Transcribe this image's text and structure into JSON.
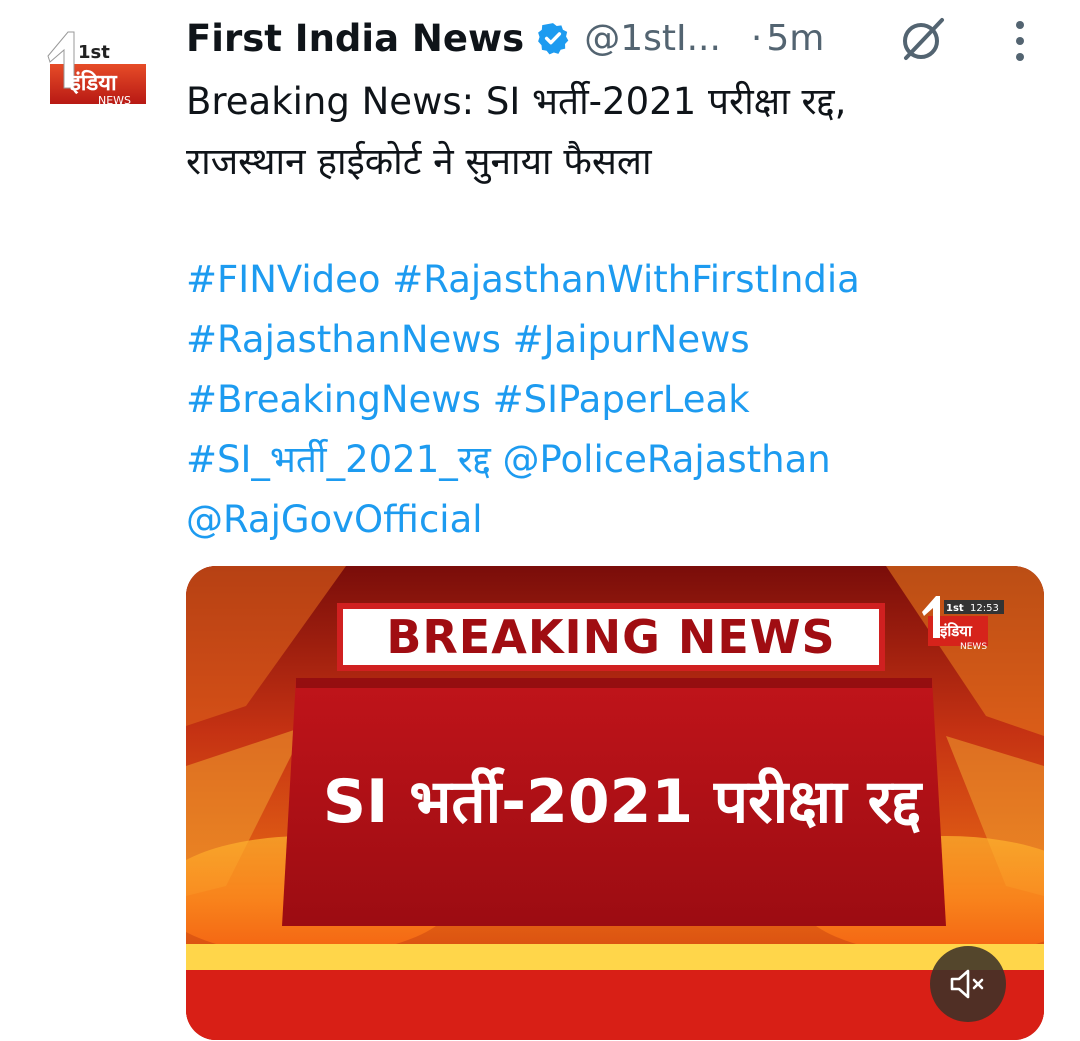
{
  "tweet": {
    "author_name": "First India News",
    "handle": "@1stI...",
    "separator": "·",
    "time": "5m",
    "text_lines": [
      "Breaking News: SI भर्ती-2021 परीक्षा रद्द,",
      "राजस्थान हाईकोर्ट ने सुनाया फैसला"
    ],
    "hashtag_lines": [
      "#FINVideo #RajasthanWithFirstIndia",
      "#RajasthanNews #JaipurNews",
      "#BreakingNews  #SIPaperLeak",
      "#SI_भर्ती_2021_रद्द @PoliceRajasthan",
      "@RajGovOfficial"
    ]
  },
  "avatar_logo": {
    "top": "1st",
    "middle": "इंडिया",
    "bottom": "NEWS"
  },
  "video": {
    "banner": "BREAKING NEWS",
    "headline": "SI भर्ती-2021 परीक्षा रद्द",
    "logo_time": "12:53",
    "logo_top": "1st",
    "logo_middle": "इंडिया",
    "logo_bottom": "NEWS"
  },
  "icons": {
    "verified": "verified-badge-icon",
    "grok": "grok-icon",
    "more": "more-options-icon",
    "mute": "mute-icon"
  },
  "colors": {
    "link": "#1d9bf0",
    "secondary_text": "#536471",
    "verified": "#1d9bf0",
    "brand_red": "#c8102e"
  }
}
